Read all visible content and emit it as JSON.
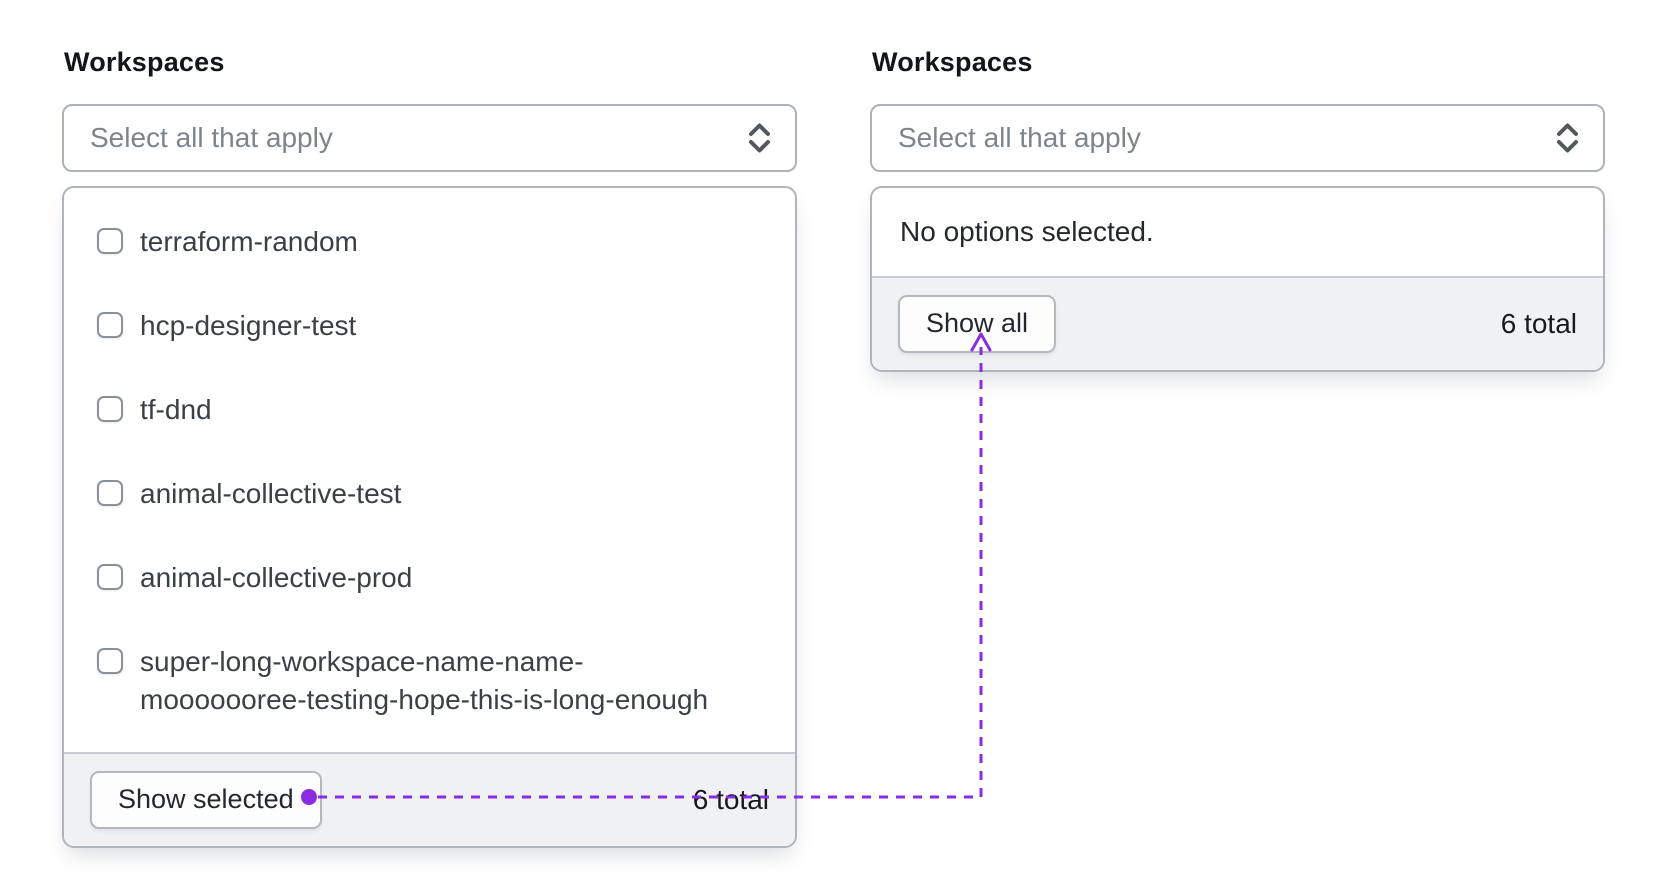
{
  "left": {
    "label": "Workspaces",
    "select": {
      "placeholder": "Select all that apply"
    },
    "options": [
      {
        "label": "terraform-random",
        "checked": false
      },
      {
        "label": "hcp-designer-test",
        "checked": false
      },
      {
        "label": "tf-dnd",
        "checked": false
      },
      {
        "label": "animal-collective-test",
        "checked": false
      },
      {
        "label": "animal-collective-prod",
        "checked": false
      },
      {
        "label": "super-long-workspace-name-name-mooooooree-testing-hope-this-is-long-enough",
        "checked": false
      }
    ],
    "footer": {
      "button": "Show selected",
      "total": "6 total"
    }
  },
  "right": {
    "label": "Workspaces",
    "select": {
      "placeholder": "Select all that apply"
    },
    "empty_message": "No options selected.",
    "footer": {
      "button": "Show all",
      "total": "6 total"
    }
  },
  "icons": {
    "select_caret": "unfold-more-icon"
  },
  "annotation": {
    "color": "#8b2ce2",
    "style": "dotted-connector"
  }
}
